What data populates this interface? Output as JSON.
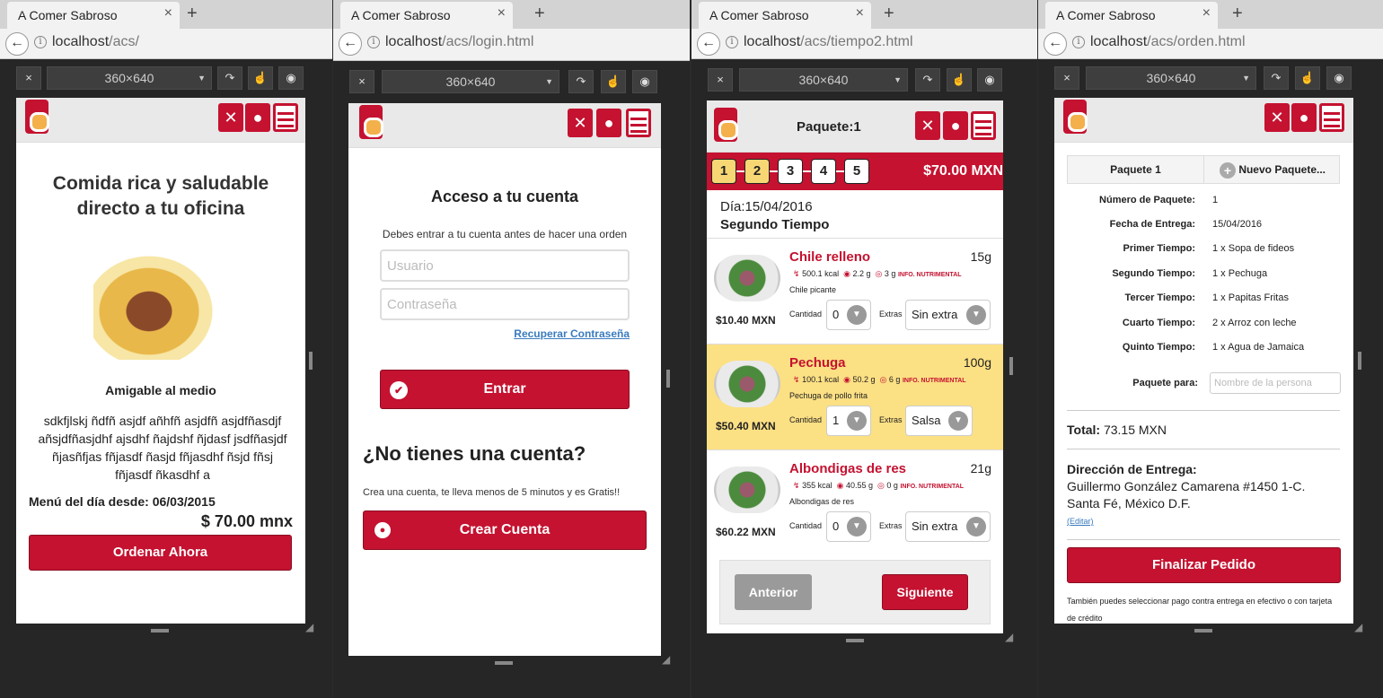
{
  "browser": {
    "tab_title": "A Comer Sabroso",
    "device": "360×640",
    "close_symbol": "×",
    "new_tab_symbol": "+"
  },
  "colors": {
    "brand": "#c41230",
    "highlight": "#fce084",
    "gray_btn": "#9a9a9a"
  },
  "icons": [
    "fork-knife-icon",
    "user-icon",
    "hamburger-menu-icon",
    "check-icon",
    "person-icon",
    "plus-circle-icon",
    "chevron-down-icon"
  ],
  "home": {
    "url": "localhost",
    "url_path": "/acs/",
    "headline": "Comida rica y saludable directo a tu oficina",
    "subtitle": "Amigable al medio",
    "body": "sdkfjlskj ñdfñ asjdf añhfñ asjdfñ asjdfñasdjf añsjdfñasjdhf ajsdhf ñajdshf ñjdasf jsdfñasjdf ñjasñfjas fñjasdf ñasjd fñjasdhf ñsjd fñsj fñjasdf ñkasdhf a",
    "menu_label": "Menú del día desde: 06/03/2015",
    "price": "$ 70.00 mnx",
    "order_button": "Ordenar Ahora"
  },
  "login": {
    "url": "localhost",
    "url_path": "/acs/login.html",
    "title": "Acceso a tu cuenta",
    "notice": "Debes entrar a tu cuenta antes de hacer una orden",
    "user_placeholder": "Usuario",
    "password_placeholder": "Contraseña",
    "recover_link": "Recuperar Contraseña",
    "enter_button": "Entrar",
    "no_account": "¿No tienes una cuenta?",
    "create_text": "Crea una cuenta, te lleva menos de 5 minutos y es Gratis!!",
    "create_button": "Crear Cuenta"
  },
  "tiempo": {
    "url": "localhost",
    "url_path": "/acs/tiempo2.html",
    "title": "Paquete:1",
    "steps": [
      "1",
      "2",
      "3",
      "4",
      "5"
    ],
    "total": "$70.00 MXN",
    "day": "Día:15/04/2016",
    "course": "Segundo Tiempo",
    "dishes": [
      {
        "name": "Chile relleno",
        "weight": "15g",
        "kcal": "500.1 kcal",
        "carbs": "2.2 g",
        "fat": "3 g",
        "info": "INFO. NUTRIMENTAL",
        "desc": "Chile picante",
        "price": "$10.40 MXN",
        "qty_label": "Cantidad",
        "qty": "0",
        "extras_label": "Extras",
        "extra": "Sin extra"
      },
      {
        "name": "Pechuga",
        "weight": "100g",
        "kcal": "100.1 kcal",
        "carbs": "50.2 g",
        "fat": "6 g",
        "info": "INFO. NUTRIMENTAL",
        "desc": "Pechuga de pollo frita",
        "price": "$50.40 MXN",
        "qty_label": "Cantidad",
        "qty": "1",
        "extras_label": "Extras",
        "extra": "Salsa"
      },
      {
        "name": "Albondigas de res",
        "weight": "21g",
        "kcal": "355 kcal",
        "carbs": "40.55 g",
        "fat": "0 g",
        "info": "INFO. NUTRIMENTAL",
        "desc": "Albondigas de res",
        "price": "$60.22 MXN",
        "qty_label": "Cantidad",
        "qty": "0",
        "extras_label": "Extras",
        "extra": "Sin extra"
      }
    ],
    "prev_button": "Anterior",
    "next_button": "Siguiente"
  },
  "orden": {
    "url": "localhost",
    "url_path": "/acs/orden.html",
    "tab1": "Paquete 1",
    "tab2": "Nuevo Paquete...",
    "rows": [
      {
        "k": "Número de Paquete:",
        "v": "1"
      },
      {
        "k": "Fecha de Entrega:",
        "v": "15/04/2016"
      },
      {
        "k": "Primer Tiempo:",
        "v": "1 x Sopa de fideos"
      },
      {
        "k": "Segundo Tiempo:",
        "v": "1 x Pechuga"
      },
      {
        "k": "Tercer Tiempo:",
        "v": "1 x Papitas Fritas"
      },
      {
        "k": "Cuarto Tiempo:",
        "v": "2 x Arroz con leche"
      },
      {
        "k": "Quinto Tiempo:",
        "v": "1 x Agua de Jamaica"
      }
    ],
    "for_label": "Paquete para:",
    "for_placeholder": "Nombre de la persona",
    "total_label": "Total:",
    "total_value": "73.15 MXN",
    "address_label": "Dirección de Entrega:",
    "address_line1": "Guillermo González Camarena #1450 1-C.",
    "address_line2": "Santa Fé, México D.F.",
    "edit_link": "(Editar)",
    "finalize_button": "Finalizar Pedido",
    "note": "También puedes seleccionar pago contra entrega en efectivo o con tarjeta de crédito"
  }
}
